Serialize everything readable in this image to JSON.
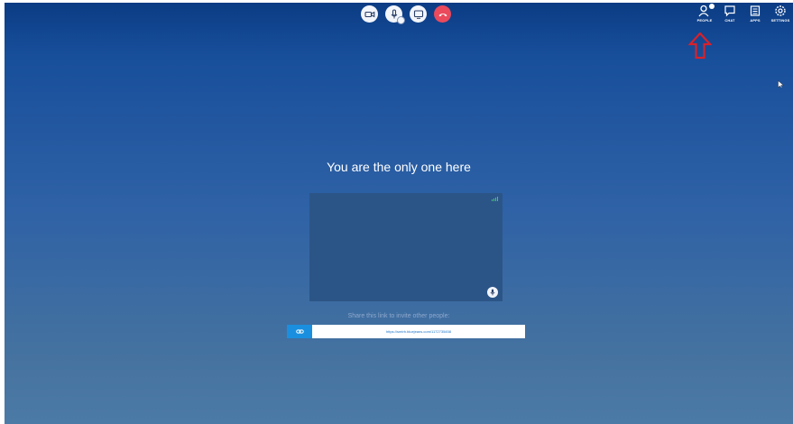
{
  "top_controls": {
    "items": [
      {
        "icon": "camera-icon"
      },
      {
        "icon": "microphone-icon"
      },
      {
        "icon": "screen-share-icon"
      },
      {
        "icon": "hangup-icon",
        "color": "#ea4a5c"
      }
    ]
  },
  "nav": {
    "people": {
      "label": "PEOPLE",
      "icon": "people-icon"
    },
    "chat": {
      "label": "CHAT",
      "icon": "chat-icon"
    },
    "apps": {
      "label": "APPS",
      "icon": "apps-icon"
    },
    "settings": {
      "label": "SETTINGS",
      "icon": "gear-icon"
    }
  },
  "annotation": {
    "icon": "red-arrow-icon",
    "color": "#d9212a"
  },
  "main": {
    "headline": "You are the only one here",
    "invite_text": "Share this link to invite other people:",
    "invite_link": "https://smtrh.bluejeans.com/1172735458"
  },
  "colors": {
    "background_top": "#0b3c84",
    "background_bottom": "#4c7aa6",
    "tile": "#2c5587",
    "link_button": "#1a8fe0"
  }
}
